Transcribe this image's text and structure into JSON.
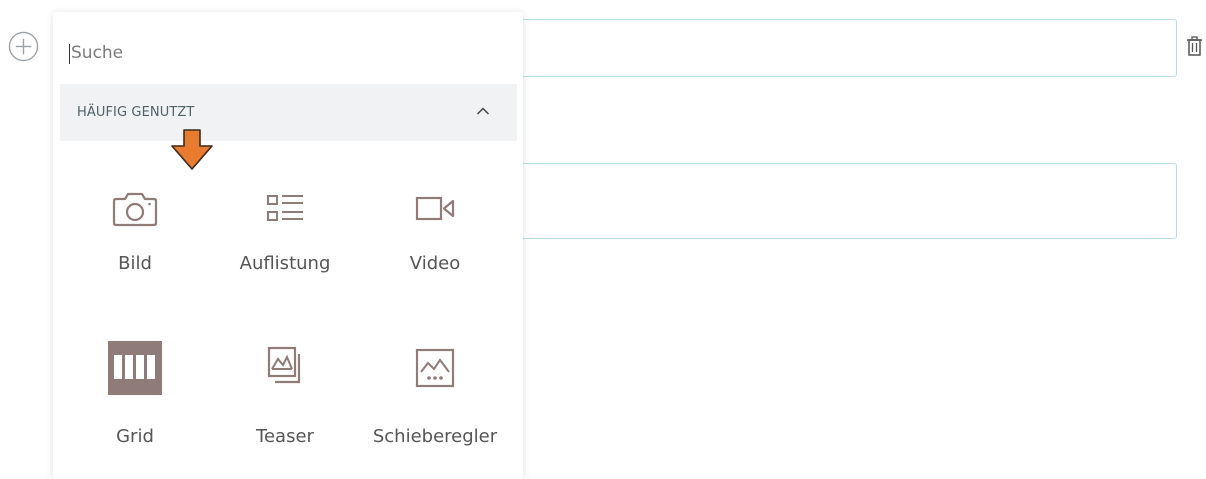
{
  "search": {
    "placeholder": "Suche",
    "value": ""
  },
  "section": {
    "title": "HÄUFIG GENUTZT",
    "collapse_icon": "chevron-up-icon"
  },
  "blocks": [
    {
      "label": "Bild",
      "icon": "camera-icon"
    },
    {
      "label": "Auflistung",
      "icon": "list-icon"
    },
    {
      "label": "Video",
      "icon": "video-icon"
    },
    {
      "label": "Grid",
      "icon": "grid-icon"
    },
    {
      "label": "Teaser",
      "icon": "teaser-icon"
    },
    {
      "label": "Schieberegler",
      "icon": "slider-icon"
    }
  ],
  "colors": {
    "icon": "#8f7b78",
    "accent_arrow": "#e87b2e",
    "field_border": "#b9dbe3",
    "header_bg": "#f0f2f3"
  }
}
